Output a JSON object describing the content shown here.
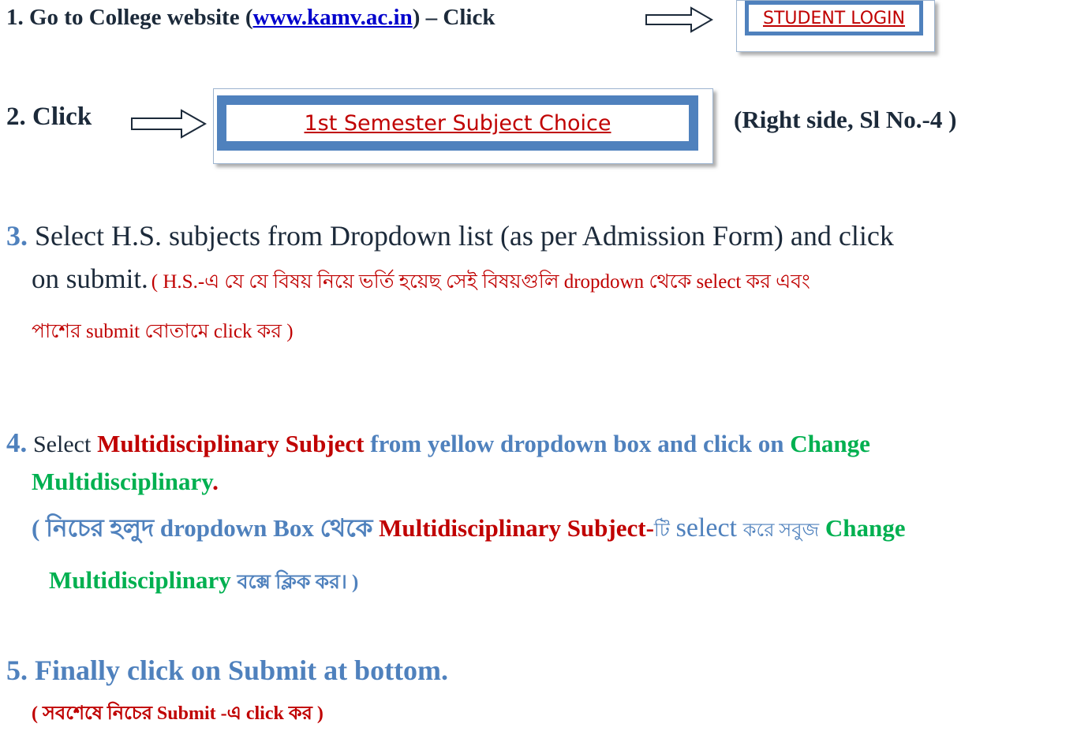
{
  "step1": {
    "number": "1.",
    "text_before": "Go to College website (",
    "link": "www.kamv.ac.in",
    "text_after": ") – Click",
    "button_label": "STUDENT LOGIN"
  },
  "step2": {
    "number": "2.",
    "text": "Click",
    "button_label": "1st Semester Subject Choice",
    "note": "(Right side, Sl No.-4 )"
  },
  "step3": {
    "number": "3.",
    "text_line1": "Select H.S. subjects from Dropdown list (as per Admission Form) and click",
    "text_line2": "on submit.",
    "bengali_line1": "( H.S.-এ যে যে বিষয় নিয়ে ভর্তি হয়েছ সেই বিষয়গুলি dropdown থেকে select কর এবং",
    "bengali_line2": "পাশের submit বোতামে click কর )"
  },
  "step4": {
    "number": "4.",
    "select": "Select",
    "subject": "Multidisciplinary Subject",
    "mid": "from yellow dropdown box and click on",
    "change": "Change",
    "multi": "Multidisciplinary",
    "period": ".",
    "bn_open": "( নিচের হলুদ dropdown Box থেকে",
    "bn_subject": "Multidisciplinary Subject-",
    "bn_ti": "টি",
    "bn_select": "select",
    "bn_kore": "করে সবুজ",
    "bn_change": "Change",
    "bn_multi": "Multidisciplinary",
    "bn_end": "বক্সে ক্লিক কর। )"
  },
  "step5": {
    "number": "5.",
    "text": "Finally click on Submit at bottom.",
    "bengali": "( সবশেষে নিচের Submit -এ click কর )"
  },
  "colors": {
    "red": "#c00000",
    "blue": "#4f81bd",
    "green": "#00b050",
    "link": "#0000cc"
  }
}
